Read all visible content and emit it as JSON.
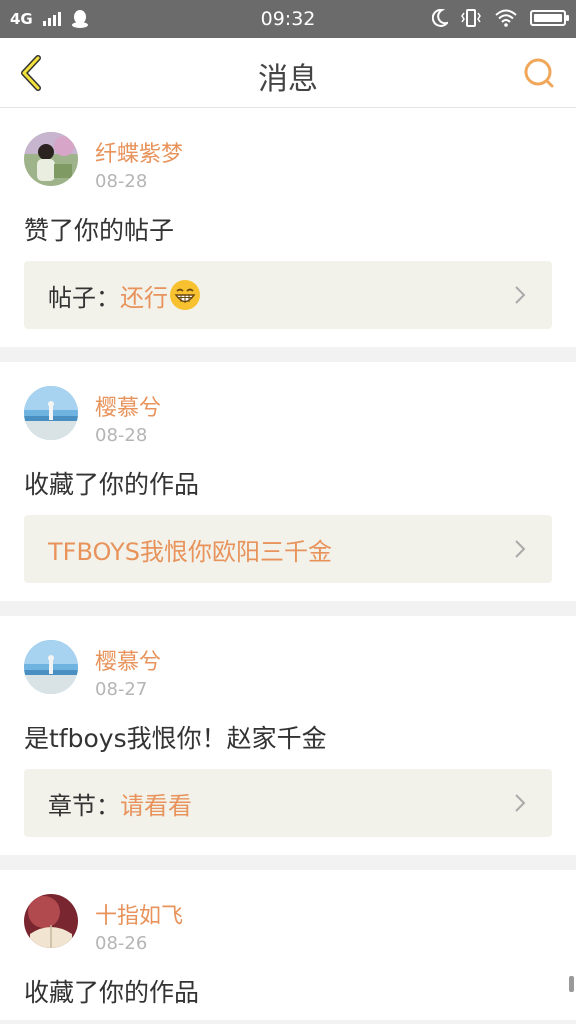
{
  "status_bar": {
    "network": "4G",
    "time": "09:32",
    "icons": [
      "signal-icon",
      "qq-icon",
      "moon-icon",
      "vibrate-icon",
      "wifi-icon",
      "battery-icon"
    ]
  },
  "header": {
    "title": "消息",
    "back_icon": "chevron-left-icon",
    "search_icon": "search-icon",
    "accent_color": "#f0a75a"
  },
  "messages": [
    {
      "user": "纤蝶紫梦",
      "date": "08-28",
      "action": "赞了你的帖子",
      "ref_label": "帖子：",
      "ref_value": "还行",
      "ref_emoji": "grin-emoji-icon"
    },
    {
      "user": "樱慕兮",
      "date": "08-28",
      "action": "收藏了你的作品",
      "ref_label": "",
      "ref_value": "TFBOYS我恨你欧阳三千金"
    },
    {
      "user": "樱慕兮",
      "date": "08-27",
      "action": "是tfboys我恨你！赵家千金",
      "ref_label": "章节：",
      "ref_value": "请看看"
    },
    {
      "user": "十指如飞",
      "date": "08-26",
      "action": "收藏了你的作品"
    }
  ],
  "colors": {
    "username": "#e8935b",
    "ref_background": "#f2f2ea"
  }
}
